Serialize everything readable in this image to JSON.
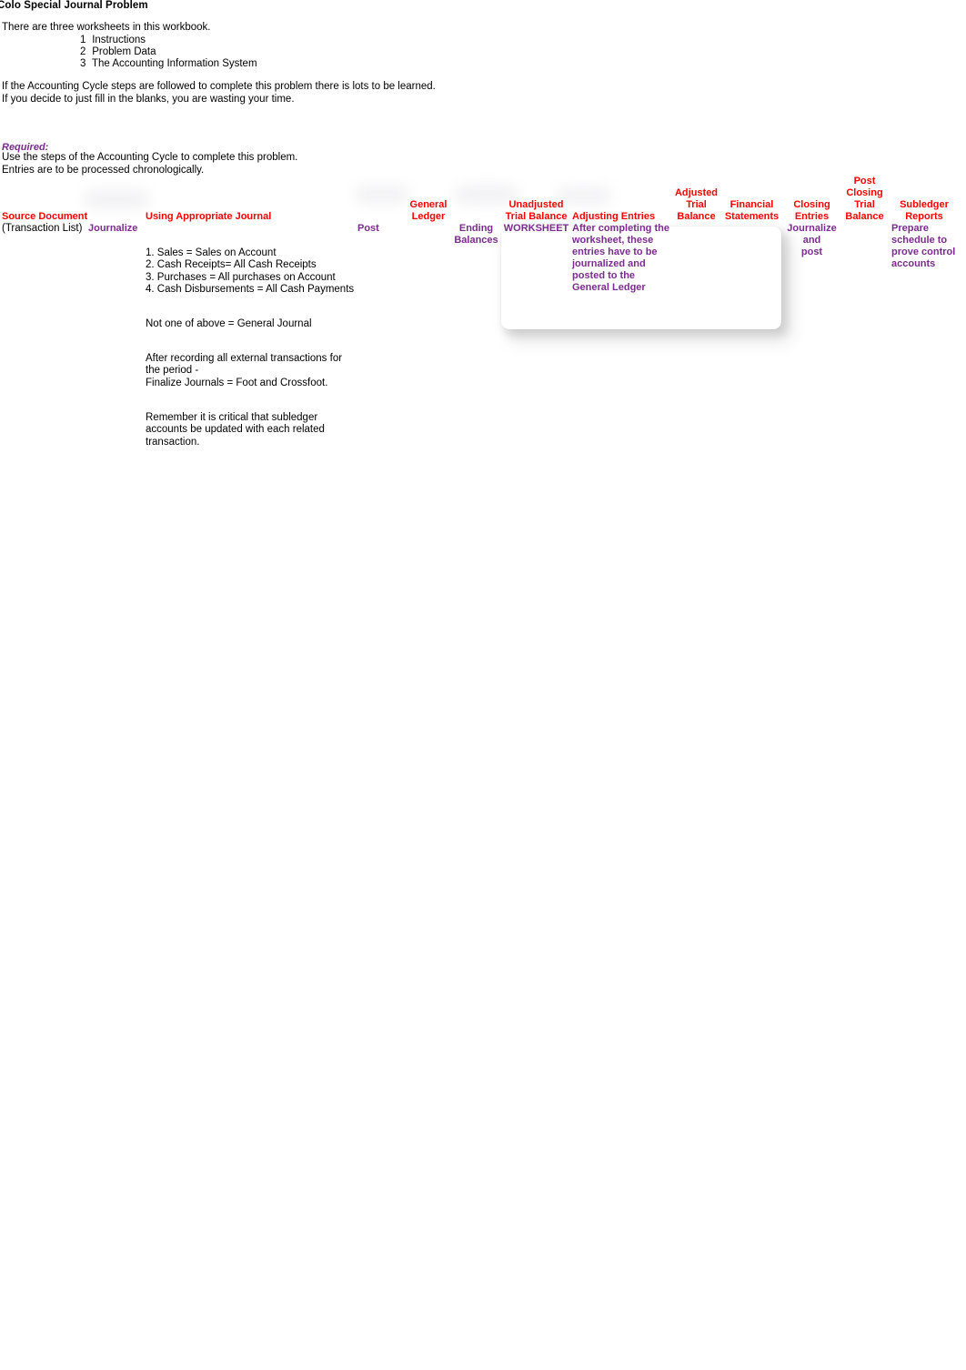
{
  "document": {
    "title": "Colo Special Journal Problem",
    "intro": "There are three worksheets in this workbook.",
    "worksheets": [
      {
        "num": "1",
        "label": "Instructions"
      },
      {
        "num": "2",
        "label": "Problem Data"
      },
      {
        "num": "3",
        "label": "The Accounting Information System"
      }
    ],
    "cycle_note_line1": "If the Accounting Cycle steps are followed to complete this problem there is lots to be learned.",
    "cycle_note_line2": "If you decide to just fill in the blanks, you are wasting your time.",
    "required_heading": "Required:",
    "required_line1": "Use the steps of the Accounting Cycle to complete this problem.",
    "required_line2": "Entries are to be processed chronologically."
  },
  "colors": {
    "heading_red": "#FF0000",
    "accent_purple": "#7B2C8E",
    "body_black": "#000000",
    "page_background": "#FFFFFF"
  },
  "workflow": {
    "columns": [
      {
        "id": "source-document",
        "heading": "Source Document",
        "heading_sub_black": "(Transaction List)",
        "sub": ""
      },
      {
        "id": "journalize",
        "heading": "",
        "sub": "Journalize"
      },
      {
        "id": "using-appropriate-journal",
        "heading": "Using Appropriate Journal",
        "sub": ""
      },
      {
        "id": "post",
        "heading": "",
        "sub": "Post"
      },
      {
        "id": "general-ledger",
        "heading": "General\nLedger",
        "sub": ""
      },
      {
        "id": "ending-balances",
        "heading": "",
        "sub": "Ending\nBalances"
      },
      {
        "id": "unadjusted-trial-balance",
        "heading": "Unadjusted\nTrial Balance",
        "sub": "WORKSHEET"
      },
      {
        "id": "adjusting-entries",
        "heading": "Adjusting Entries",
        "sub": "After completing the worksheet, these entries have to be journalized and posted to the General Ledger"
      },
      {
        "id": "adjusted-trial-balance",
        "heading": "Adjusted\nTrial\nBalance",
        "sub": ""
      },
      {
        "id": "financial-statements",
        "heading": "Financial\nStatements",
        "sub": ""
      },
      {
        "id": "closing-entries",
        "heading": "Closing\nEntries",
        "sub": "Journalize\nand\npost"
      },
      {
        "id": "post-closing-trial-balance",
        "heading": "Post\nClosing\nTrial\nBalance",
        "sub": ""
      },
      {
        "id": "subledger-reports",
        "heading": "Subledger\nReports",
        "sub": "Prepare\nschedule to\nprove control\naccounts"
      }
    ],
    "labels": {
      "source_document": "Source Document",
      "transaction_list": "(Transaction List)",
      "journalize": "Journalize",
      "using_appropriate_journal": "Using Appropriate Journal",
      "post": "Post",
      "general_ledger_l1": "General",
      "general_ledger_l2": "Ledger",
      "ending_l1": "Ending",
      "ending_l2": "Balances",
      "unadjusted_l1": "Unadjusted",
      "unadjusted_l2": "Trial Balance",
      "worksheet": "WORKSHEET",
      "adjusting_entries": "Adjusting Entries",
      "adjusting_note_l1": "After completing the",
      "adjusting_note_l2": "worksheet, these",
      "adjusting_note_l3": "entries have to be",
      "adjusting_note_l4": "journalized and",
      "adjusting_note_l5": "posted to the",
      "adjusting_note_l6": "General Ledger",
      "adjusted_tb_l1": "Adjusted",
      "adjusted_tb_l2": "Trial",
      "adjusted_tb_l3": "Balance",
      "financial_l1": "Financial",
      "financial_l2": "Statements",
      "closing_l1": "Closing",
      "closing_l2": "Entries",
      "closing_sub_l1": "Journalize",
      "closing_sub_l2": "and",
      "closing_sub_l3": "post",
      "pctb_l1": "Post",
      "pctb_l2": "Closing",
      "pctb_l3": "Trial",
      "pctb_l4": "Balance",
      "subledger_l1": "Subledger",
      "subledger_l2": "Reports",
      "subledger_sub_l1": "Prepare",
      "subledger_sub_l2": "schedule to",
      "subledger_sub_l3": "prove control",
      "subledger_sub_l4": "accounts"
    }
  },
  "notes": {
    "journal_types": [
      "1. Sales  = Sales on Account",
      "2. Cash Receipts= All Cash Receipts",
      "3. Purchases = All purchases on Account",
      "4.  Cash Disbursements = All Cash Payments"
    ],
    "general_journal": "Not one of above = General Journal",
    "finalize": [
      "After recording all external transactions for",
      "the period -",
      "Finalize Journals = Foot and Crossfoot."
    ],
    "subledger": [
      "Remember it is critical that subledger",
      "accounts be updated with each related",
      "transaction."
    ]
  }
}
